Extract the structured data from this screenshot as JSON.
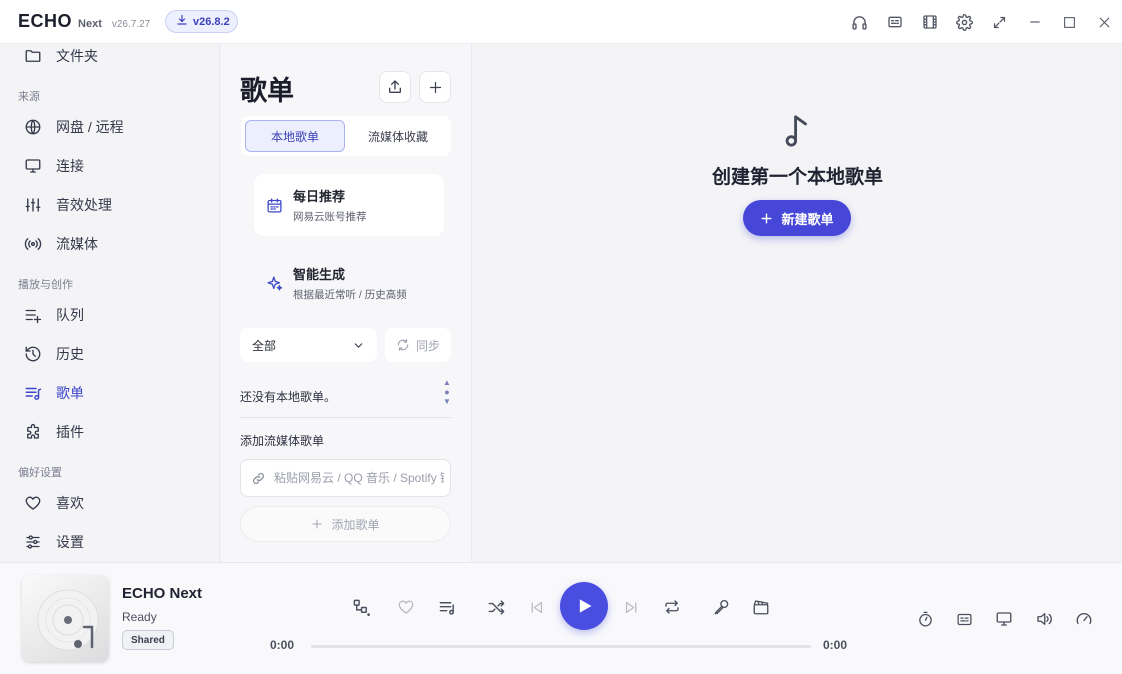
{
  "app": {
    "name": "ECHO",
    "sub": "Next",
    "version": "v26.7.27",
    "update_version": "v26.8.2"
  },
  "titlebar_icons": [
    "headphones-icon",
    "lyrics-card-icon",
    "film-icon",
    "gear-icon",
    "fullscreen-icon",
    "minimize-icon",
    "maximize-icon",
    "close-icon"
  ],
  "sidebar": {
    "top_item": "文件夹",
    "sections": [
      {
        "label": "来源",
        "items": [
          "网盘 / 远程",
          "连接",
          "音效处理",
          "流媒体"
        ]
      },
      {
        "label": "播放与创作",
        "items": [
          "队列",
          "历史",
          "歌单",
          "插件"
        ]
      },
      {
        "label": "偏好设置",
        "items": [
          "喜欢",
          "设置"
        ]
      }
    ],
    "active_item": "歌单"
  },
  "playlist_panel": {
    "title": "歌单",
    "tabs": [
      "本地歌单",
      "流媒体收藏"
    ],
    "active_tab": "本地歌单",
    "cards": [
      {
        "title": "每日推荐",
        "subtitle": "网易云账号推荐",
        "icon": "calendar-icon"
      },
      {
        "title": "智能生成",
        "subtitle": "根据最近常听 / 历史高频",
        "icon": "sparkle-icon"
      }
    ],
    "filter_value": "全部",
    "sync_label": "同步",
    "empty_note": "还没有本地歌单。",
    "add_streaming_label": "添加流媒体歌单",
    "url_placeholder": "粘贴网易云 / QQ 音乐 / Spotify 链接",
    "add_button": "添加歌单"
  },
  "main": {
    "empty_title": "创建第一个本地歌单",
    "new_button": "新建歌单"
  },
  "player": {
    "title": "ECHO Next",
    "status": "Ready",
    "badge": "Shared",
    "time_current": "0:00",
    "time_total": "0:00",
    "progress": 0,
    "accent": "#4a4ee0"
  }
}
